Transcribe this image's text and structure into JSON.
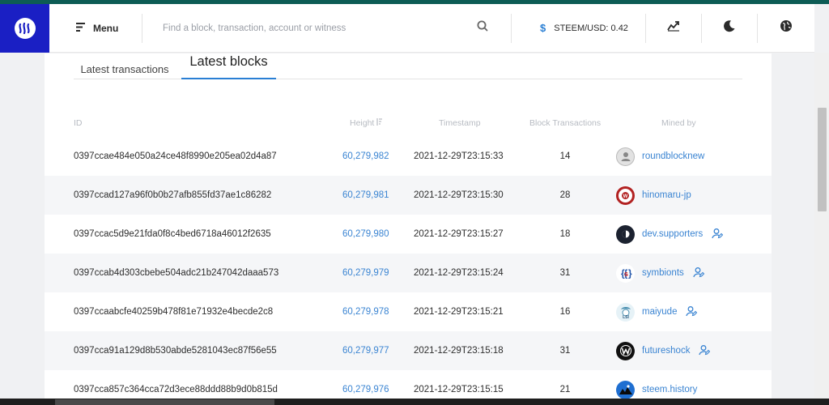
{
  "header": {
    "menu_label": "Menu",
    "search_placeholder": "Find a block, transaction, account or witness",
    "price_label": "STEEM/USD: 0.42",
    "icons": [
      "steem-logo-icon",
      "menu-icon",
      "search-icon",
      "dollar-icon",
      "chart-icon",
      "moon-icon",
      "globe-icon"
    ]
  },
  "tabs": [
    {
      "label": "Latest transactions",
      "active": false
    },
    {
      "label": "Latest blocks",
      "active": true
    }
  ],
  "table": {
    "columns": [
      "ID",
      "Height",
      "Timestamp",
      "Block Transactions",
      "Mined by"
    ],
    "rows": [
      {
        "id": "0397ccae484e050a24ce48f8990e205ea02d4a87",
        "height": "60,279,982",
        "timestamp": "2021-12-29T23:15:33",
        "tx": "14",
        "miner": "roundblocknew",
        "witness_icon": false,
        "avatar_color": "#d9d9d9"
      },
      {
        "id": "0397ccad127a96f0b0b27afb855fd37ae1c86282",
        "height": "60,279,981",
        "timestamp": "2021-12-29T23:15:30",
        "tx": "28",
        "miner": "hinomaru-jp",
        "witness_icon": false,
        "avatar_color": "#b22222"
      },
      {
        "id": "0397ccac5d9e21fda0f8c4bed6718a46012f2635",
        "height": "60,279,980",
        "timestamp": "2021-12-29T23:15:27",
        "tx": "18",
        "miner": "dev.supporters",
        "witness_icon": true,
        "avatar_color": "#1c2230"
      },
      {
        "id": "0397ccab4d303cbebe504adc21b247042daaa573",
        "height": "60,279,979",
        "timestamp": "2021-12-29T23:15:24",
        "tx": "31",
        "miner": "symbionts",
        "witness_icon": true,
        "avatar_color": "#ffffff"
      },
      {
        "id": "0397ccaabcfe40259b478f81e71932e4becde2c8",
        "height": "60,279,978",
        "timestamp": "2021-12-29T23:15:21",
        "tx": "16",
        "miner": "maiyude",
        "witness_icon": true,
        "avatar_color": "#e6f2f7"
      },
      {
        "id": "0397cca91a129d8b530abde5281043ec87f56e55",
        "height": "60,279,977",
        "timestamp": "2021-12-29T23:15:18",
        "tx": "31",
        "miner": "futureshock",
        "witness_icon": true,
        "avatar_color": "#111111"
      },
      {
        "id": "0397cca857c364cca72d3ece88ddd88b9d0b815d",
        "height": "60,279,976",
        "timestamp": "2021-12-29T23:15:15",
        "tx": "21",
        "miner": "steem.history",
        "witness_icon": false,
        "avatar_color": "#1f6fd1"
      }
    ]
  },
  "colors": {
    "accent": "#2a7fd4",
    "logo_bg": "#1a1fc4",
    "link": "#3a84d2",
    "top_strip": "#0d5c55"
  }
}
